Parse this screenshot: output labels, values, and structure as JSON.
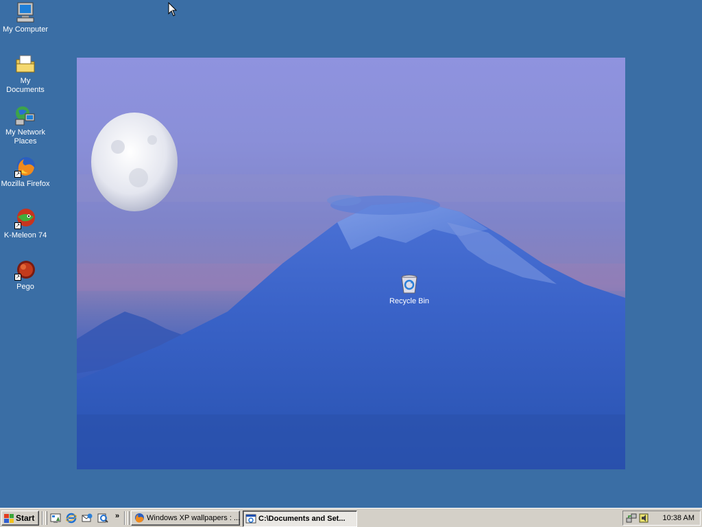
{
  "desktop": {
    "background_color": "#3a6ea5",
    "icons": [
      {
        "label": "My Computer",
        "icon": "my-computer-icon"
      },
      {
        "label": "My Documents",
        "icon": "my-documents-icon"
      },
      {
        "label": "My Network Places",
        "icon": "network-places-icon"
      },
      {
        "label": "Mozilla Firefox",
        "icon": "firefox-icon"
      },
      {
        "label": "K-Meleon 74",
        "icon": "k-meleon-icon"
      },
      {
        "label": "Pego",
        "icon": "pego-icon"
      },
      {
        "label": "Recycle Bin",
        "icon": "recycle-bin-icon"
      }
    ]
  },
  "taskbar": {
    "start_label": "Start",
    "quick_launch": [
      "show-desktop-icon",
      "internet-explorer-icon",
      "outlook-express-icon",
      "search-icon"
    ],
    "chevron": "»",
    "tasks": [
      {
        "label": "Windows XP wallpapers : ...",
        "icon": "firefox-icon",
        "active": false
      },
      {
        "label": "C:\\Documents and Set...",
        "icon": "explorer-window-icon",
        "active": true
      }
    ],
    "tray_icons": [
      "network-tray-icon",
      "volume-tray-icon"
    ],
    "clock": "10:38 AM"
  }
}
